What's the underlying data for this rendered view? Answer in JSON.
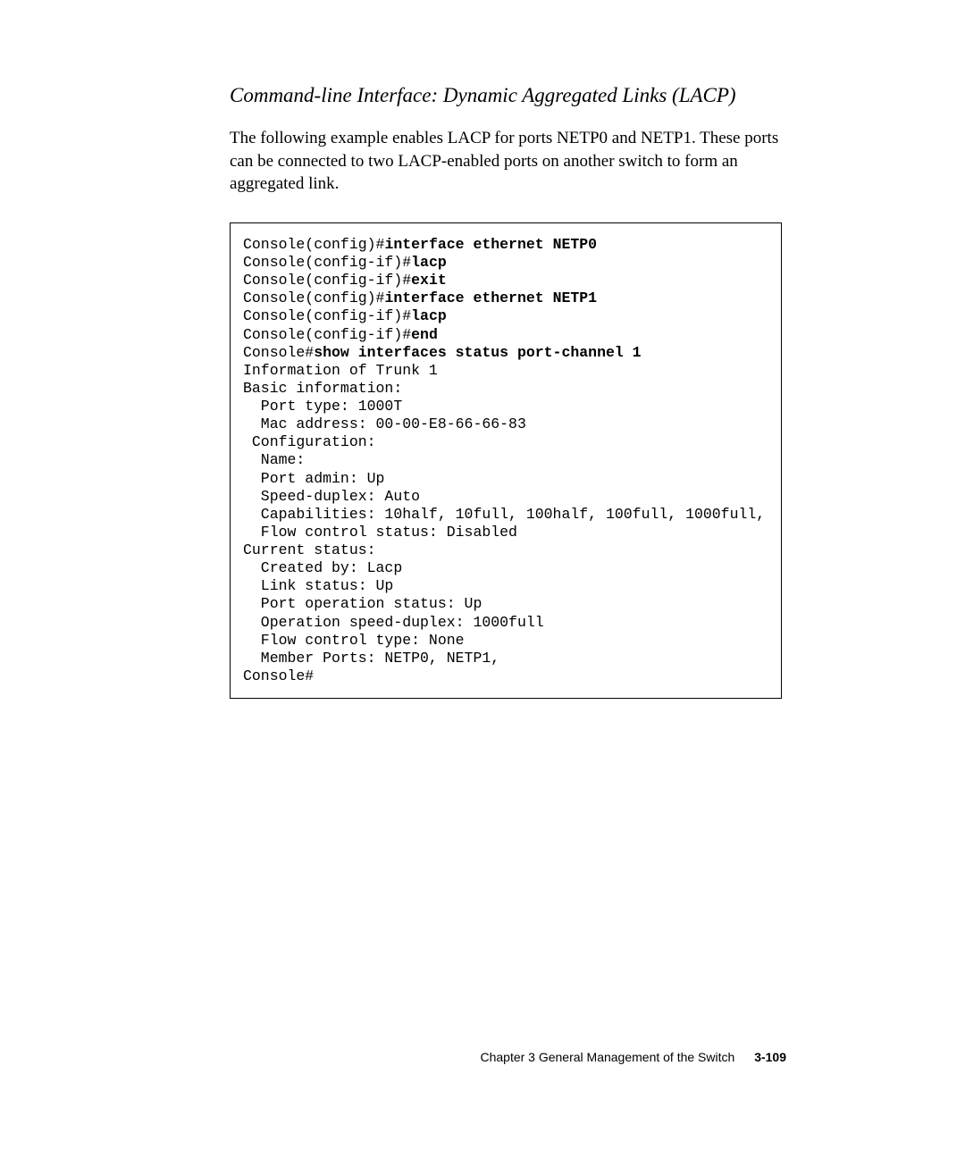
{
  "heading": "Command-line Interface: Dynamic Aggregated Links (LACP)",
  "paragraph": "The following example enables LACP for ports NETP0 and NETP1. These ports can be connected to two LACP-enabled ports on another switch to form an aggregated link.",
  "code": {
    "l1a": "Console(config)#",
    "l1b": "interface ethernet NETP0",
    "l2a": "Console(config-if)#",
    "l2b": "lacp",
    "l3a": "Console(config-if)#",
    "l3b": "exit",
    "l4a": "Console(config)#",
    "l4b": "interface ethernet NETP1",
    "l5a": "Console(config-if)#",
    "l5b": "lacp",
    "l6a": "Console(config-if)#",
    "l6b": "end",
    "l7a": "Console#",
    "l7b": "show interfaces status port-channel 1",
    "l8": "Information of Trunk 1",
    "l9": "Basic information:",
    "l10": "  Port type: 1000T",
    "l11": "  Mac address: 00-00-E8-66-66-83",
    "l12": " Configuration:",
    "l13": "  Name:",
    "l14": "  Port admin: Up",
    "l15": "  Speed-duplex: Auto",
    "l16": "  Capabilities: 10half, 10full, 100half, 100full, 1000full,",
    "l17": "  Flow control status: Disabled",
    "l18": "Current status:",
    "l19": "  Created by: Lacp",
    "l20": "  Link status: Up",
    "l21": "  Port operation status: Up",
    "l22": "  Operation speed-duplex: 1000full",
    "l23": "  Flow control type: None",
    "l24": "  Member Ports: NETP0, NETP1,",
    "l25": "Console#"
  },
  "footer": {
    "chapter": "Chapter 3   General Management of the Switch",
    "page": "3-109"
  }
}
